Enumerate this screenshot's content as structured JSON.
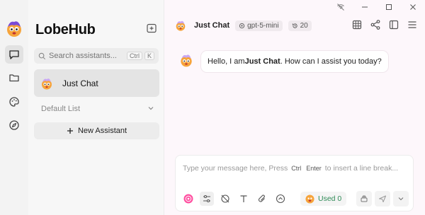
{
  "app": {
    "brand": "LobeHub"
  },
  "sidebar": {
    "search_placeholder": "Search assistants...",
    "search_kbd": [
      "Ctrl",
      "K"
    ],
    "active_chat": "Just Chat",
    "list_title": "Default List",
    "new_assistant_label": "New Assistant"
  },
  "chat_header": {
    "title": "Just Chat",
    "model": "gpt-5-mini",
    "history_count": "20"
  },
  "message": {
    "prefix": "Hello, I am ",
    "name": "Just Chat",
    "suffix": ". How can I assist you today?"
  },
  "composer": {
    "placeholder_start": "Type your message here, Press",
    "kbd_1": "Ctrl",
    "kbd_2": "Enter",
    "placeholder_end": "to insert a line break...",
    "used_label": "Used 0"
  },
  "colors": {
    "accent": "#ff4fa0",
    "used_text": "#2e8b57"
  }
}
